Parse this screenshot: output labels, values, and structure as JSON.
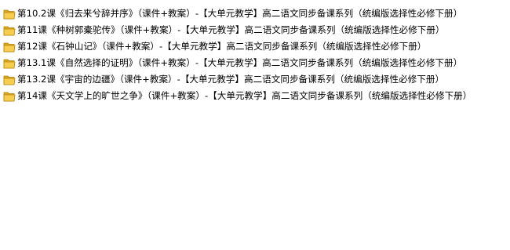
{
  "files": [
    {
      "icon": "folder-icon",
      "name": "第10.2课《归去来兮辞并序》（课件+教案）-【大单元教学】高二语文同步备课系列（统编版选择性必修下册）"
    },
    {
      "icon": "folder-icon",
      "name": "第11课《种树郭橐驼传》（课件+教案）-【大单元教学】高二语文同步备课系列（统编版选择性必修下册）"
    },
    {
      "icon": "folder-icon",
      "name": "第12课《石钟山记》（课件+教案）-【大单元教学】高二语文同步备课系列（统编版选择性必修下册）"
    },
    {
      "icon": "folder-icon",
      "name": "第13.1课《自然选择的证明》（课件+教案）-【大单元教学】高二语文同步备课系列（统编版选择性必修下册）"
    },
    {
      "icon": "folder-icon",
      "name": "第13.2课《宇宙的边疆》（课件+教案）-【大单元教学】高二语文同步备课系列（统编版选择性必修下册）"
    },
    {
      "icon": "folder-icon",
      "name": "第14课《天文学上的旷世之争》（课件+教案）-【大单元教学】高二语文同步备课系列（统编版选择性必修下册）"
    }
  ],
  "colors": {
    "folder_back": "#D9A520",
    "folder_front": "#F6CD4F",
    "folder_edge": "#B8860B",
    "text": "#000000"
  }
}
